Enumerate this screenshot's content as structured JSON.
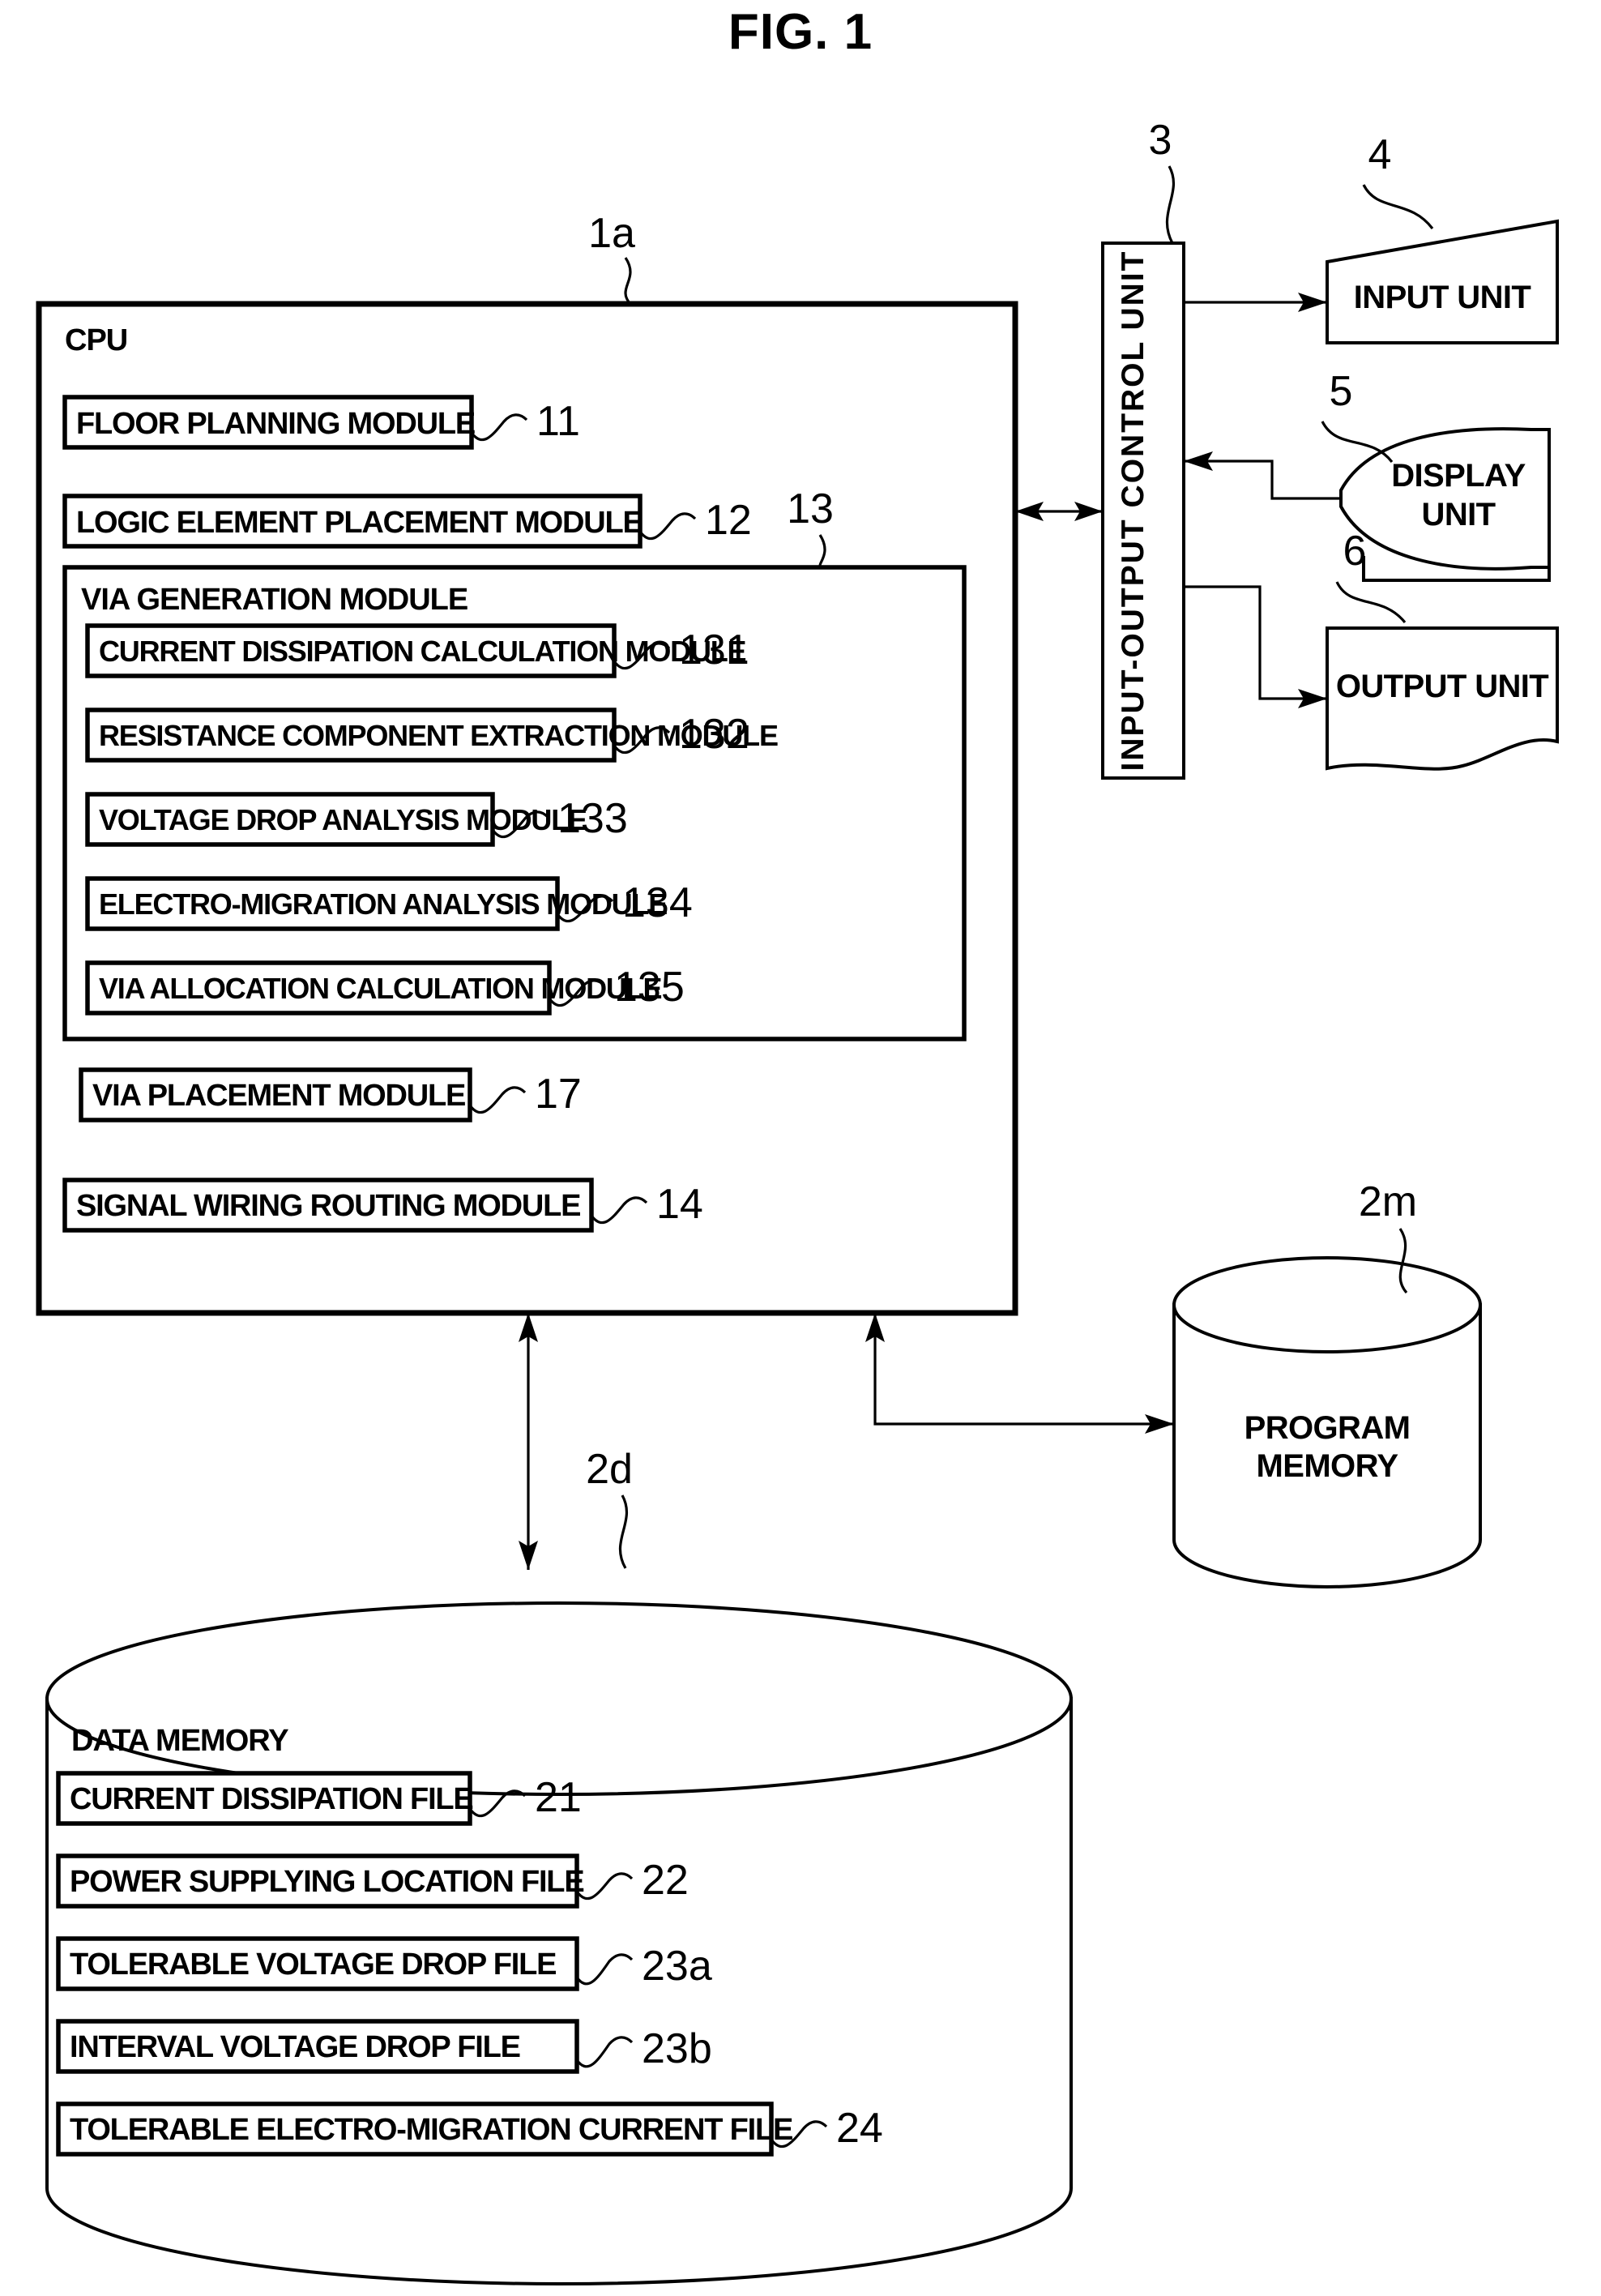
{
  "figure": {
    "title": "FIG. 1",
    "type": "patent-block-diagram"
  },
  "cpu": {
    "label": "CPU",
    "ref": "1a",
    "modules": [
      {
        "label": "FLOOR PLANNING MODULE",
        "ref": "11"
      },
      {
        "label": "LOGIC ELEMENT PLACEMENT MODULE",
        "ref": "12"
      }
    ],
    "via_generation": {
      "label": "VIA GENERATION MODULE",
      "ref": "13",
      "submodules": [
        {
          "label": "CURRENT DISSIPATION CALCULATION MODULE",
          "ref": "131"
        },
        {
          "label": "RESISTANCE COMPONENT EXTRACTION MODULE",
          "ref": "132"
        },
        {
          "label": "VOLTAGE DROP ANALYSIS MODULE",
          "ref": "133"
        },
        {
          "label": "ELECTRO-MIGRATION ANALYSIS MODULE",
          "ref": "134"
        },
        {
          "label": "VIA ALLOCATION CALCULATION MODULE",
          "ref": "135"
        }
      ]
    },
    "modules_after": [
      {
        "label": "VIA PLACEMENT MODULE",
        "ref": "17"
      },
      {
        "label": "SIGNAL WIRING ROUTING MODULE",
        "ref": "14"
      }
    ]
  },
  "io_control_unit": {
    "label": "INPUT-OUTPUT CONTROL UNIT",
    "ref": "3"
  },
  "peripherals": [
    {
      "label": "INPUT UNIT",
      "ref": "4",
      "shape": "keyboard-trapezoid"
    },
    {
      "label_line1": "DISPLAY",
      "label_line2": "UNIT",
      "ref": "5",
      "shape": "crt-monitor"
    },
    {
      "label": "OUTPUT UNIT",
      "ref": "6",
      "shape": "document-wavy"
    }
  ],
  "program_memory": {
    "label_line1": "PROGRAM",
    "label_line2": "MEMORY",
    "ref": "2m",
    "shape": "cylinder"
  },
  "data_memory": {
    "label": "DATA MEMORY",
    "ref": "2d",
    "shape": "cylinder",
    "files": [
      {
        "label": "CURRENT DISSIPATION FILE",
        "ref": "21"
      },
      {
        "label": "POWER SUPPLYING LOCATION FILE",
        "ref": "22"
      },
      {
        "label": "TOLERABLE VOLTAGE DROP FILE",
        "ref": "23a"
      },
      {
        "label": "INTERVAL VOLTAGE DROP FILE",
        "ref": "23b"
      },
      {
        "label": "TOLERABLE ELECTRO-MIGRATION CURRENT FILE",
        "ref": "24"
      }
    ]
  },
  "colors": {
    "ink": "#000000",
    "paper": "#ffffff"
  }
}
